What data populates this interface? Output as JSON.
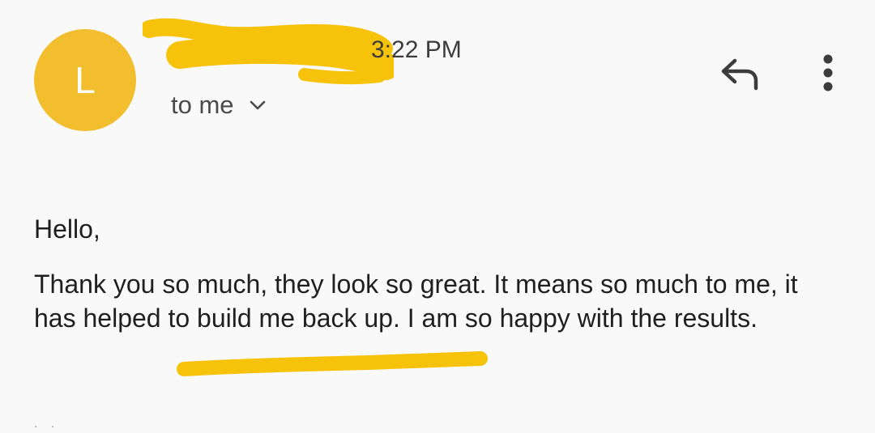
{
  "sender": {
    "avatar_letter": "L",
    "name": "",
    "time": "3:22 PM"
  },
  "recipient": {
    "label": "to me"
  },
  "actions": {
    "reply_icon": "reply-arrow-icon",
    "more_icon": "more-vert-icon"
  },
  "message": {
    "greeting": "Hello,",
    "body": "Thank you so much, they look so great. It means so much to me, it has helped to build me back up. I am so happy with the results.",
    "trimmed_indicator": ". ."
  },
  "colors": {
    "avatar": "#f2be2e",
    "highlighter": "#f7c20a",
    "background": "#f9f9f9",
    "text": "#1f1f1f"
  }
}
